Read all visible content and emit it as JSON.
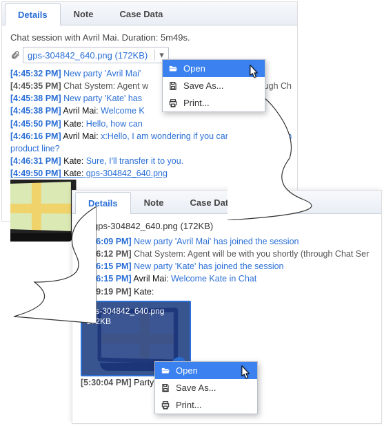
{
  "tabs": {
    "details": "Details",
    "note": "Note",
    "casedata": "Case Data"
  },
  "panel1": {
    "summary": "Chat session with Avril Mai. Duration: 5m49s.",
    "attachment": "gps-304842_640.png (172KB)",
    "log": [
      {
        "cls": "blue",
        "ts": "[4:45:32 PM]",
        "who": "",
        "txt": " New party 'Avril Mai' "
      },
      {
        "cls": "gray",
        "ts": "[4:45:35 PM]",
        "who": " Chat System:",
        "txt": " Agent w",
        "tail": "hrough Ch"
      },
      {
        "cls": "blue",
        "ts": "[4:45:38 PM]",
        "who": "",
        "txt": " New party 'Kate' has "
      },
      {
        "cls": "blue nameblack",
        "ts": "[4:45:38 PM]",
        "who": " Avril Mai:",
        "txt": " Welcome K"
      },
      {
        "cls": "blue nameblack",
        "ts": "[4:45:50 PM]",
        "who": " Kate:",
        "txt": " Hello, how can "
      },
      {
        "cls": "blue nameblack",
        "ts": "[4:46:16 PM]",
        "who": " Avril Mai:",
        "txt": " x:Hello, I am wondering if you can send me informa"
      },
      {
        "cls": "blue",
        "ts": "",
        "who": "",
        "txt": "product line?"
      },
      {
        "cls": "blue nameblack",
        "ts": "[4:46:31 PM]",
        "who": " Kate:",
        "txt": " Sure, I'll transfer it to you."
      },
      {
        "cls": "blue nameblack link",
        "ts": "[4:49:50 PM]",
        "who": " Kate:",
        "txt": " gps-304842_640.png"
      }
    ]
  },
  "panel2": {
    "attachment": "gps-304842_640.png (172KB)",
    "thumb": {
      "name": "gps-304842_640.png",
      "size": "172KB"
    },
    "log_pre": [
      {
        "cls": "blue",
        "ts": "[3:16:09 PM]",
        "who": "",
        "txt": " New party 'Avril Mai' has joined the session"
      },
      {
        "cls": "gray",
        "ts": "[3:16:12 PM]",
        "who": " Chat System:",
        "txt": " Agent will be with you shortly (through Chat Ser"
      },
      {
        "cls": "blue",
        "ts": "[3:16:15 PM]",
        "who": "",
        "txt": " New party 'Kate' has joined the session"
      },
      {
        "cls": "blue nameblack",
        "ts": "[3:16:15 PM]",
        "who": " Avril Mai:",
        "txt": " Welcome Kate in Chat"
      },
      {
        "cls": "gray nameblack",
        "ts": "[3:19:19 PM]",
        "who": " Kate:",
        "txt": ""
      }
    ],
    "log_post": [
      {
        "cls": "gray nameblack",
        "ts": "[5:30:04 PM]",
        "who": " Party '",
        "txt": ""
      }
    ]
  },
  "menu": {
    "open": "Open",
    "saveas": "Save As...",
    "print": "Print..."
  }
}
